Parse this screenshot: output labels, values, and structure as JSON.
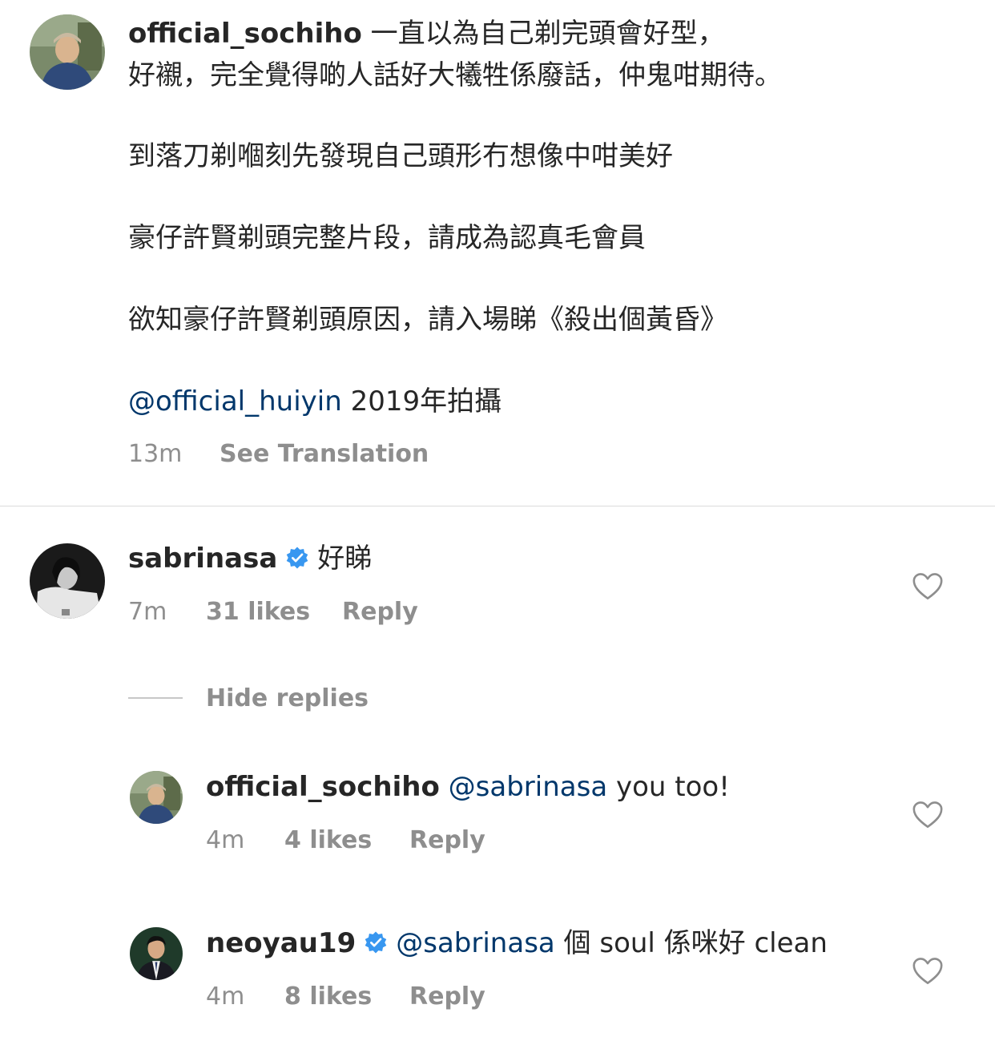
{
  "caption": {
    "username": "official_sochiho",
    "line1": "一直以為自己剃完頭會好型，",
    "line2": "好襯，完全覺得啲人話好大犧牲係廢話，仲鬼咁期待。",
    "line3": "到落刀剃嗰刻先發現自己頭形冇想像中咁美好",
    "line4": "豪仔許賢剃頭完整片段，請成為認真毛會員",
    "line5": "欲知豪仔許賢剃頭原因，請入場睇《殺出個黃昏》",
    "mention": "@official_huiyin",
    "line6_rest": " 2019年拍攝",
    "time": "13m",
    "see_translation": "See Translation"
  },
  "comments": [
    {
      "username": "sabrinasa",
      "verified": true,
      "text": "好睇",
      "time": "7m",
      "likes": "31 likes",
      "reply": "Reply"
    }
  ],
  "hide_replies": "Hide replies",
  "replies": [
    {
      "username": "official_sochiho",
      "verified": false,
      "mention": "@sabrinasa",
      "text": " you too!",
      "time": "4m",
      "likes": "4 likes",
      "reply": "Reply"
    },
    {
      "username": "neoyau19",
      "verified": true,
      "mention": "@sabrinasa",
      "text": " 個 soul 係咪好 clean",
      "time": "4m",
      "likes": "8 likes",
      "reply": "Reply"
    }
  ],
  "icons": {
    "verified_badge": "verified-badge-icon",
    "like": "heart-outline-icon"
  },
  "colors": {
    "mention": "#00376b",
    "verified": "#3897f0",
    "meta": "#8e8e8e",
    "text": "#262626"
  }
}
